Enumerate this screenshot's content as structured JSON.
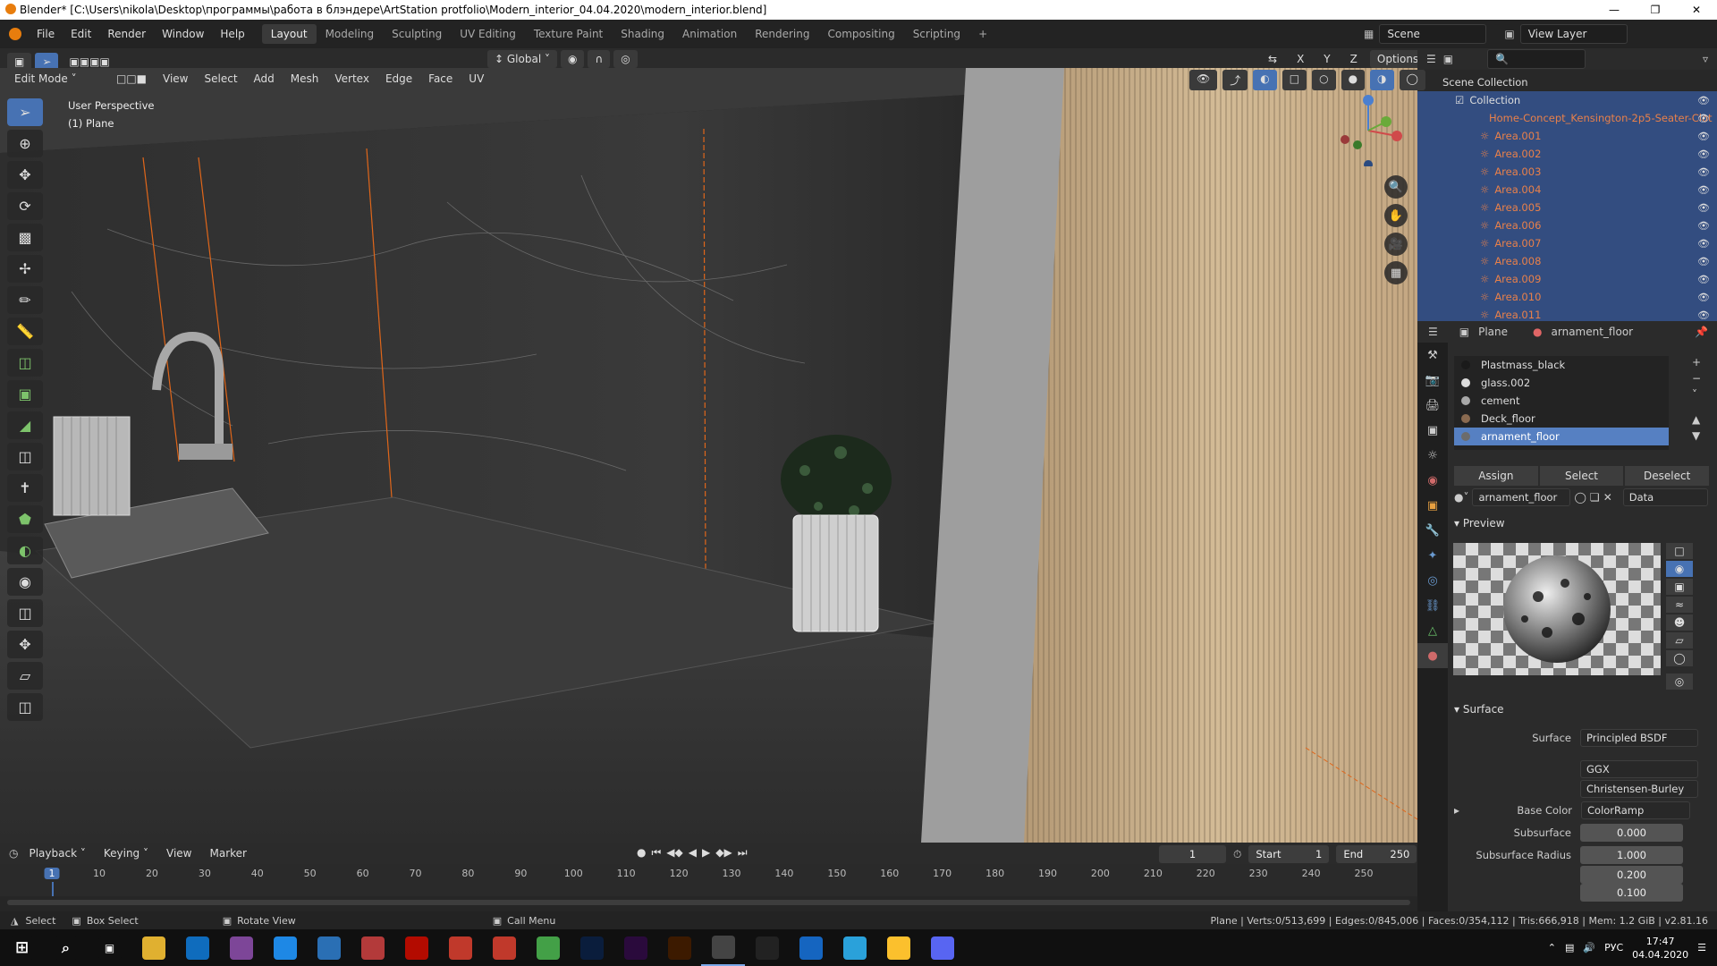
{
  "window": {
    "title": "Blender* [C:\\Users\\nikola\\Desktop\\программы\\работа в блэндере\\ArtStation protfolio\\Modern_interior_04.04.2020\\modern_interior.blend]"
  },
  "menu": [
    "File",
    "Edit",
    "Render",
    "Window",
    "Help"
  ],
  "workspaces": [
    "Layout",
    "Modeling",
    "Sculpting",
    "UV Editing",
    "Texture Paint",
    "Shading",
    "Animation",
    "Rendering",
    "Compositing",
    "Scripting"
  ],
  "active_workspace": "Layout",
  "scene": {
    "name": "Scene",
    "view_layer": "View Layer"
  },
  "viewport_header": {
    "mode": "Edit Mode",
    "menus": [
      "View",
      "Select",
      "Add",
      "Mesh",
      "Vertex",
      "Edge",
      "Face",
      "UV"
    ],
    "orientation": "Global",
    "options": "Options",
    "axes": [
      "X",
      "Y",
      "Z"
    ]
  },
  "viewport": {
    "perspective": "User Perspective",
    "object": "(1) Plane"
  },
  "outliner": {
    "root": "Scene Collection",
    "collection": "Collection",
    "items": [
      "Home-Concept_Kensington-2p5-Seater-Clot",
      "Area.001",
      "Area.002",
      "Area.003",
      "Area.004",
      "Area.005",
      "Area.006",
      "Area.007",
      "Area.008",
      "Area.009",
      "Area.010",
      "Area.011"
    ]
  },
  "properties": {
    "object": "Plane",
    "material": "arnament_floor",
    "slots": [
      {
        "name": "Plastmass_black",
        "color": "#1a1a1a"
      },
      {
        "name": "glass.002",
        "color": "#dcdcdc"
      },
      {
        "name": "cement",
        "color": "#a8a8a8"
      },
      {
        "name": "Deck_floor",
        "color": "#8a6a50"
      },
      {
        "name": "arnament_floor",
        "color": "#6c6c6c"
      }
    ],
    "slot_buttons": [
      "Assign",
      "Select",
      "Deselect"
    ],
    "link": "Data",
    "preview_title": "Preview",
    "surface_title": "Surface",
    "surface": [
      {
        "label": "Surface",
        "value": "Principled BSDF"
      },
      {
        "label": "",
        "value": "GGX"
      },
      {
        "label": "",
        "value": "Christensen-Burley"
      },
      {
        "label": "Base Color",
        "value": "ColorRamp"
      },
      {
        "label": "Subsurface",
        "value": "0.000"
      },
      {
        "label": "Subsurface Radius",
        "value": "1.000"
      },
      {
        "label": "",
        "value": "0.200"
      },
      {
        "label": "",
        "value": "0.100"
      }
    ]
  },
  "timeline": {
    "menus": [
      "Playback",
      "Keying",
      "View",
      "Marker"
    ],
    "current_frame": "1",
    "start_label": "Start",
    "start": "1",
    "end_label": "End",
    "end": "250",
    "ticks": [
      "1",
      "10",
      "20",
      "30",
      "40",
      "50",
      "60",
      "70",
      "80",
      "90",
      "100",
      "110",
      "120",
      "130",
      "140",
      "150",
      "160",
      "170",
      "180",
      "190",
      "200",
      "210",
      "220",
      "230",
      "240",
      "250"
    ]
  },
  "statusbar": {
    "select": "Select",
    "box_select": "Box Select",
    "rotate": "Rotate View",
    "call_menu": "Call Menu",
    "stats": "Plane | Verts:0/513,699 | Edges:0/845,006 | Faces:0/354,112 | Tris:666,918 | Mem: 1.2 GiB | v2.81.16"
  },
  "taskbar": {
    "apps": [
      {
        "icon": "start-icon",
        "color": "#101010"
      },
      {
        "icon": "search-icon",
        "color": "#101010"
      },
      {
        "icon": "task-view-icon",
        "color": "#101010"
      },
      {
        "icon": "file-explorer-icon",
        "color": "#e0b030"
      },
      {
        "icon": "mail-icon",
        "color": "#0f6cbd"
      },
      {
        "icon": "tor-icon",
        "color": "#7d4698"
      },
      {
        "icon": "edge-icon",
        "color": "#1e88e5"
      },
      {
        "icon": "unity-icon",
        "color": "#2a6fb4"
      },
      {
        "icon": "winrar-icon",
        "color": "#b33a3a"
      },
      {
        "icon": "acrobat-icon",
        "color": "#b30b00"
      },
      {
        "icon": "steam-red-icon",
        "color": "#c0392b"
      },
      {
        "icon": "substance-icon",
        "color": "#c0392b"
      },
      {
        "icon": "corel-icon",
        "color": "#43a047"
      },
      {
        "icon": "photoshop-icon",
        "color": "#0a1d3c"
      },
      {
        "icon": "premiere-icon",
        "color": "#2a0a3c"
      },
      {
        "icon": "illustrator-icon",
        "color": "#3c1a00"
      },
      {
        "icon": "blender-icon",
        "color": "#444"
      },
      {
        "icon": "marvelous-icon",
        "color": "#222"
      },
      {
        "icon": "photos-icon",
        "color": "#1565c0"
      },
      {
        "icon": "telegram-icon",
        "color": "#2aa1da"
      },
      {
        "icon": "chrome-icon",
        "color": "#fbc02d"
      },
      {
        "icon": "discord-icon",
        "color": "#5865f2"
      }
    ],
    "lang": "РУС",
    "time": "17:47",
    "date": "04.04.2020"
  }
}
